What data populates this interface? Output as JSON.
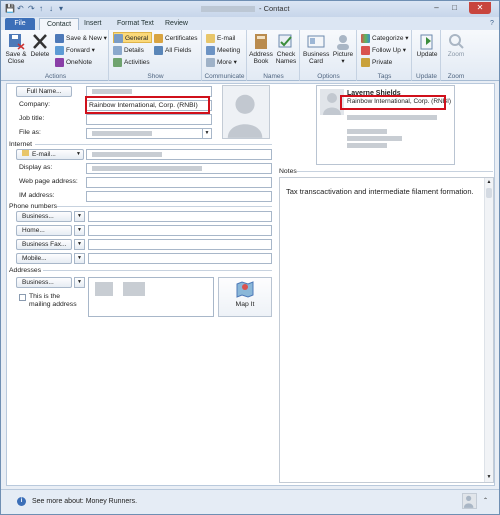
{
  "window": {
    "title": "- Contact",
    "min": "–",
    "max": "□",
    "close": "✕",
    "help": "?",
    "qat": [
      "💾",
      "↶",
      "↷",
      "↑",
      "↓",
      "▾"
    ]
  },
  "tabs": [
    "File",
    "Contact",
    "Insert",
    "Format Text",
    "Review"
  ],
  "ribbon": {
    "actions": {
      "label": "Actions",
      "save_close": "Save & Close",
      "delete": "Delete",
      "save_new": "Save & New ▾",
      "forward": "Forward ▾",
      "onenote": "OneNote"
    },
    "show": {
      "label": "Show",
      "general": "General",
      "details": "Details",
      "activities": "Activities",
      "certificates": "Certificates",
      "all_fields": "All Fields"
    },
    "communicate": {
      "label": "Communicate",
      "email": "E-mail",
      "meeting": "Meeting",
      "more": "More ▾"
    },
    "names": {
      "label": "Names",
      "address_book": "Address Book",
      "check_names": "Check Names"
    },
    "options": {
      "label": "Options",
      "business_card": "Business Card",
      "picture": "Picture ▾"
    },
    "tags": {
      "label": "Tags",
      "categorize": "Categorize ▾",
      "follow_up": "Follow Up ▾",
      "private": "Private"
    },
    "update": {
      "label": "Update",
      "update": "Update"
    },
    "zoom": {
      "label": "Zoom",
      "zoom": "Zoom"
    }
  },
  "form": {
    "full_name_button": "Full Name...",
    "company_label": "Company:",
    "company_value": "Rainbow International, Corp. (RNBI)",
    "job_title_label": "Job title:",
    "file_as_label": "File as:",
    "internet_section": "Internet",
    "email_button": "E-mail...",
    "display_as_label": "Display as:",
    "web_label": "Web page address:",
    "im_label": "IM address:",
    "phone_section": "Phone numbers",
    "business_button": "Business...",
    "home_button": "Home...",
    "fax_button": "Business Fax...",
    "mobile_button": "Mobile...",
    "addresses_section": "Addresses",
    "addr_business_button": "Business...",
    "mailing_checkbox_label": "This is the mailing address",
    "map_it": "Map It"
  },
  "card": {
    "name": "Laverne Shields",
    "company": "Rainbow International, Corp. (RNBI)"
  },
  "notes": {
    "label": "Notes",
    "text": "Tax transcactivation and intermediate filament formation."
  },
  "status": {
    "text": "See more about: Money Runners."
  },
  "colors": {
    "highlight": "#d0101b",
    "file_tab": "#3c6fb8"
  }
}
